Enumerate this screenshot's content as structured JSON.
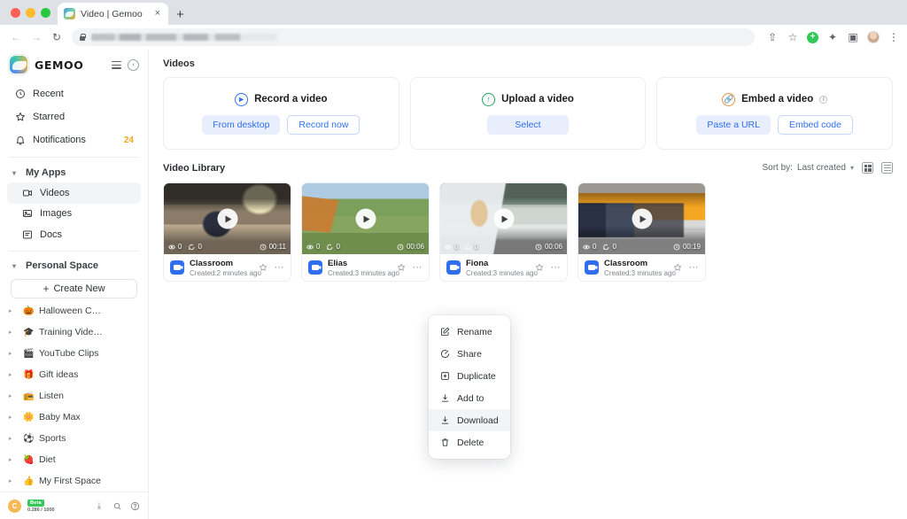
{
  "browser": {
    "tab_title": "Video | Gemoo",
    "new_tab_label": "+",
    "close_label": "×",
    "back_icon": "←",
    "forward_icon": "→",
    "reload_icon": "↻",
    "share_icon": "⇧",
    "bookmark_icon": "☆",
    "puzzle_icon": "✦",
    "sidepanel_icon": "▣",
    "menu_icon": "⋮"
  },
  "sidebar": {
    "brand": "GEMOO",
    "collapse_icon": "‹",
    "nav": [
      {
        "label": "Recent",
        "icon": "clock-icon",
        "badge": ""
      },
      {
        "label": "Starred",
        "icon": "star-icon",
        "badge": ""
      },
      {
        "label": "Notifications",
        "icon": "bell-icon",
        "badge": "24"
      }
    ],
    "my_apps": {
      "label": "My Apps",
      "items": [
        {
          "label": "Videos",
          "icon": "video-icon",
          "active": true
        },
        {
          "label": "Images",
          "icon": "image-icon",
          "active": false
        },
        {
          "label": "Docs",
          "icon": "doc-icon",
          "active": false
        }
      ]
    },
    "personal_space": {
      "label": "Personal Space",
      "create_new": "Create New",
      "spaces": [
        {
          "label": "Halloween C…",
          "emoji": "🎃"
        },
        {
          "label": "Training Vide…",
          "emoji": "🎓"
        },
        {
          "label": "YouTube Clips",
          "emoji": "🎬"
        },
        {
          "label": "Gift ideas",
          "emoji": "🎁"
        },
        {
          "label": "Listen",
          "emoji": "📻"
        },
        {
          "label": "Baby Max",
          "emoji": "🌼"
        },
        {
          "label": "Sports",
          "emoji": "⚽"
        },
        {
          "label": "Diet",
          "emoji": "🍓"
        },
        {
          "label": "My First Space",
          "emoji": "👍"
        }
      ]
    },
    "footer": {
      "avatar_initial": "C",
      "beta_label": "Beta",
      "quota": "0.286 / 1000",
      "download_icon": "⤓",
      "search_icon": "⚲",
      "help_icon": "?"
    }
  },
  "main": {
    "page_title": "Videos",
    "action_cards": [
      {
        "title": "Record a video",
        "icon": "play-circle-icon",
        "has_info": false,
        "buttons": [
          {
            "label": "From desktop",
            "style": "fill"
          },
          {
            "label": "Record now",
            "style": "outline"
          }
        ]
      },
      {
        "title": "Upload a video",
        "icon": "upload-circle-icon",
        "has_info": false,
        "buttons": [
          {
            "label": "Select",
            "style": "fill"
          }
        ]
      },
      {
        "title": "Embed a video",
        "icon": "link-circle-icon",
        "has_info": true,
        "info_glyph": "i",
        "buttons": [
          {
            "label": "Paste a URL",
            "style": "fill"
          },
          {
            "label": "Embed code",
            "style": "outline"
          }
        ]
      }
    ],
    "library": {
      "title": "Video Library",
      "sort_label": "Sort by:",
      "sort_value": "Last created",
      "sort_chevron": "⌄",
      "view_grid": "grid-view-icon",
      "view_list": "list-view-icon",
      "videos": [
        {
          "name": "Classroom",
          "created": "Created:2 minutes ago",
          "views": "0",
          "comments": "0",
          "duration": "00:11",
          "scene": "classroom-dark"
        },
        {
          "name": "Elias",
          "created": "Created:3 minutes ago",
          "views": "0",
          "comments": "0",
          "duration": "00:06",
          "scene": "park-bench"
        },
        {
          "name": "Fiona",
          "created": "Created:3 minutes ago",
          "views": "0",
          "comments": "0",
          "duration": "00:06",
          "scene": "girl-laptop"
        },
        {
          "name": "Classroom",
          "created": "Created:3 minutes ago",
          "views": "0",
          "comments": "0",
          "duration": "00:19",
          "scene": "classroom-orange"
        }
      ]
    }
  },
  "context_menu": {
    "items": [
      {
        "label": "Rename",
        "icon": "pencil-square-icon",
        "highlighted": false
      },
      {
        "label": "Share",
        "icon": "share-icon",
        "highlighted": false
      },
      {
        "label": "Duplicate",
        "icon": "duplicate-icon",
        "highlighted": false
      },
      {
        "label": "Add to",
        "icon": "add-to-icon",
        "highlighted": false
      },
      {
        "label": "Download",
        "icon": "download-icon",
        "highlighted": true
      },
      {
        "label": "Delete",
        "icon": "trash-icon",
        "highlighted": false
      }
    ]
  },
  "colors": {
    "accent": "#2f6fed",
    "accent_soft": "#e8eefc",
    "badge_orange": "#f5a623",
    "beta_green": "#34c759"
  }
}
